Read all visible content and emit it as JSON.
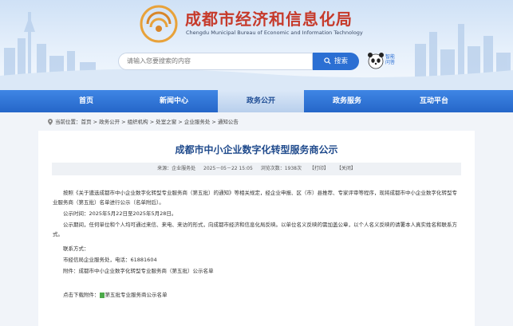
{
  "header": {
    "title_cn": "成都市经济和信息化局",
    "title_en": "Chengdu Municipal Bureau of Economic and Information Technology",
    "search_placeholder": "请输入您要搜索的内容",
    "search_button": "搜索",
    "assistant_label": "智能问答"
  },
  "nav": {
    "items": [
      {
        "label": "首页",
        "active": false
      },
      {
        "label": "新闻中心",
        "active": false
      },
      {
        "label": "政务公开",
        "active": true
      },
      {
        "label": "政务服务",
        "active": false
      },
      {
        "label": "互动平台",
        "active": false
      }
    ]
  },
  "breadcrumb": "当前位置：首页 > 政务公开 > 组织机构 > 处室之窗 > 企业服务处 > 通知公告",
  "article": {
    "title": "成都市中小企业数字化转型服务商公示",
    "meta": {
      "source": "来源：企业服务处",
      "date": "2025－05－22 15:05",
      "views": "浏览次数：1938次",
      "print": "【打印】",
      "close": "【关闭】"
    },
    "para1": "按照《关于遴选成都市中小企业数字化转型专业服务商（第五批）的通知》等相关规定，经企业申报、区（市）县推荐、专家评审等程序，现将成都市中小企业数字化转型专业服务商（第五批）名单进行公示（名单附后）。",
    "para2": "公示时间：2025年5月22日至2025年5月28日。",
    "para3": "公示期间，任何单位和个人均可通过来信、来电、来访的形式，向成都市经济和信息化局反映。以单位名义反映的需加盖公章，以个人名义反映的请署本人真实姓名和联系方式。",
    "contact_title": "联系方式：",
    "contact": "市经信局企业服务处，电话：61881604",
    "attachment": "附件：成都市中小企业数字化转型专业服务商（第五批）公示名单",
    "download_prefix": "点击下载附件：",
    "download_file": "第五批专业服务商公示名单"
  }
}
